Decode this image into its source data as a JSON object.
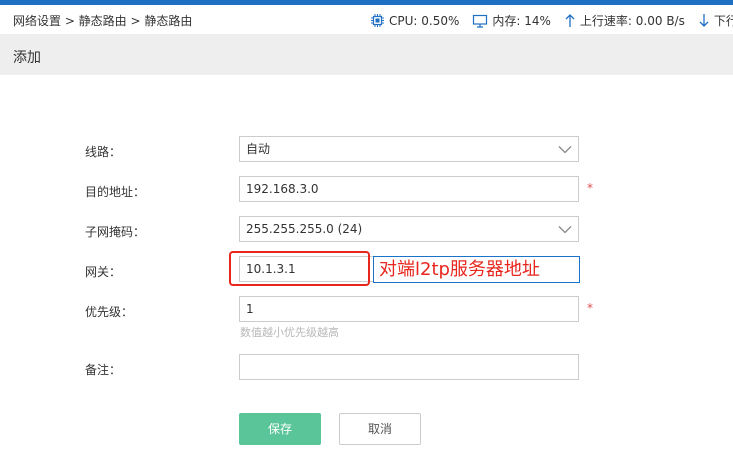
{
  "breadcrumb": "网络设置 > 静态路由 > 静态路由",
  "stats": {
    "cpu": "CPU: 0.50%",
    "memory": "内存: 14%",
    "upload": "上行速率: 0.00 B/s",
    "download": "下行"
  },
  "page_title": "添加",
  "form": {
    "line": {
      "label": "线路：",
      "value": "自动"
    },
    "destination": {
      "label": "目的地址：",
      "value": "192.168.3.0",
      "required_mark": "*"
    },
    "subnet": {
      "label": "子网掩码：",
      "value": "255.255.255.0 (24)"
    },
    "gateway": {
      "label": "网关：",
      "value": "10.1.3.1"
    },
    "priority": {
      "label": "优先级：",
      "value": "1",
      "required_mark": "*",
      "hint": "数值越小优先级越高"
    },
    "remark": {
      "label": "备注：",
      "value": ""
    }
  },
  "annotation": "对端l2tp服务器地址",
  "buttons": {
    "save": "保存",
    "cancel": "取消"
  },
  "colors": {
    "accent": "#1f6fc4",
    "save": "#5bc59a",
    "annotation": "#e8261e",
    "required": "#e0534e"
  }
}
